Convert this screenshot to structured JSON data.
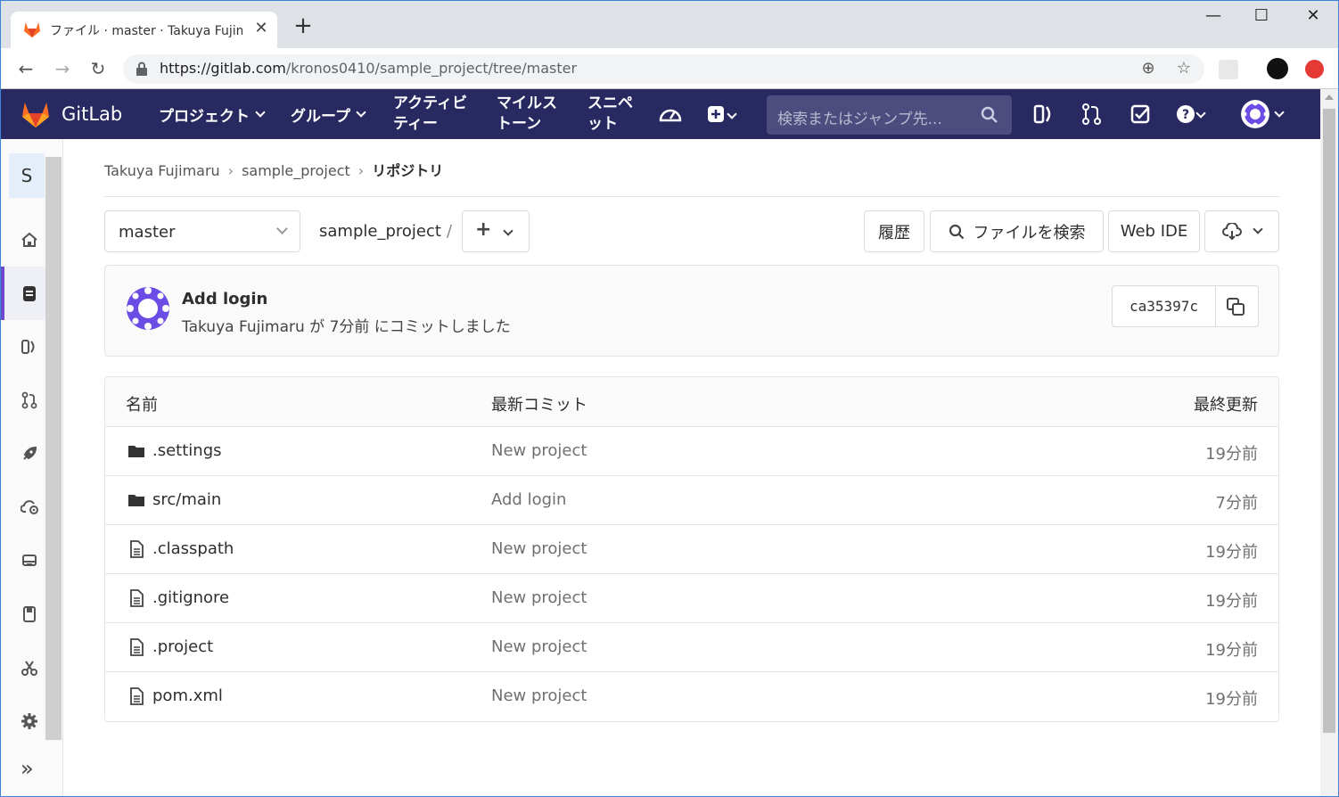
{
  "browser": {
    "tab_title": "ファイル · master · Takuya Fujimaru",
    "tab_close": "✕",
    "new_tab": "+",
    "url_host": "https://gitlab.com",
    "url_path": "/kronos0410/sample_project/tree/master"
  },
  "gitlab": {
    "brand": "GitLab",
    "nav": [
      {
        "label": "プロジェクト"
      },
      {
        "label": "グループ"
      },
      {
        "label_line1": "アクティビ",
        "label_line2": "ティー"
      },
      {
        "label_line1": "マイルス",
        "label_line2": "トーン"
      },
      {
        "label_line1": "スニペ",
        "label_line2": "ット"
      }
    ],
    "search_placeholder": "検索またはジャンプ先..."
  },
  "sidebar": {
    "project_initial": "S"
  },
  "breadcrumbs": [
    "Takuya Fujimaru",
    "sample_project",
    "リポジトリ"
  ],
  "repo": {
    "branch": "master",
    "path": "sample_project",
    "path_sep": "/",
    "buttons": {
      "history": "履歴",
      "find_file": "ファイルを検索",
      "web_ide": "Web IDE"
    }
  },
  "last_commit": {
    "title": "Add login",
    "meta": "Takuya Fujimaru が 7分前 にコミットしました",
    "sha": "ca35397c"
  },
  "tree": {
    "headers": {
      "name": "名前",
      "commit": "最新コミット",
      "updated": "最終更新"
    },
    "rows": [
      {
        "type": "folder",
        "name": ".settings",
        "commit": "New project",
        "updated": "19分前"
      },
      {
        "type": "folder",
        "name": "src/main",
        "commit": "Add login",
        "updated": "7分前"
      },
      {
        "type": "file",
        "name": ".classpath",
        "commit": "New project",
        "updated": "19分前"
      },
      {
        "type": "file",
        "name": ".gitignore",
        "commit": "New project",
        "updated": "19分前"
      },
      {
        "type": "file",
        "name": ".project",
        "commit": "New project",
        "updated": "19分前"
      },
      {
        "type": "file",
        "name": "pom.xml",
        "commit": "New project",
        "updated": "19分前"
      }
    ]
  },
  "colors": {
    "header_bg": "#292961",
    "accent": "#6e49cb",
    "gitlab_orange": "#fc6d26"
  }
}
